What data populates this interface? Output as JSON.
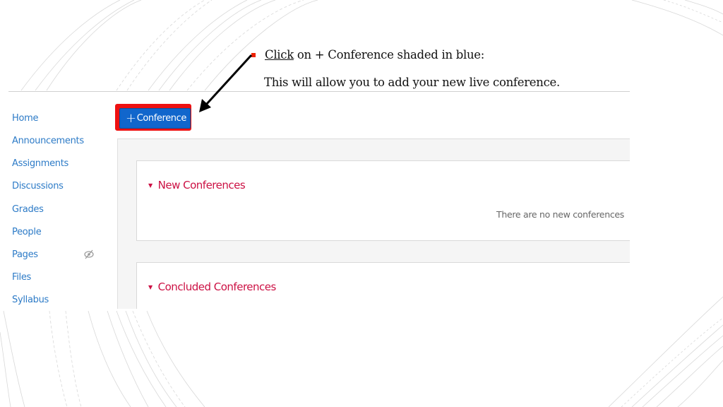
{
  "slide": {
    "instruction": {
      "link_word": "Click",
      "rest": " on + Conference shaded in blue:",
      "detail": "This will allow you to add your new live conference."
    },
    "accent_colors": {
      "bullet": "#ee2200",
      "highlight_box": "#ee1111",
      "arrow": "#000000"
    }
  },
  "sidebar": {
    "items": [
      {
        "label": "Home"
      },
      {
        "label": "Announcements"
      },
      {
        "label": "Assignments"
      },
      {
        "label": "Discussions"
      },
      {
        "label": "Grades"
      },
      {
        "label": "People"
      },
      {
        "label": "Pages",
        "icon": "eye-slash-icon"
      },
      {
        "label": "Files"
      },
      {
        "label": "Syllabus"
      }
    ]
  },
  "toolbar": {
    "add_conference": {
      "icon": "plus-icon",
      "label": "Conference",
      "color": "#1166cc"
    }
  },
  "sections": [
    {
      "title": "New Conferences",
      "empty_message": "There are no new conferences",
      "color": "#cc1144"
    },
    {
      "title": "Concluded Conferences",
      "color": "#cc1144"
    }
  ]
}
